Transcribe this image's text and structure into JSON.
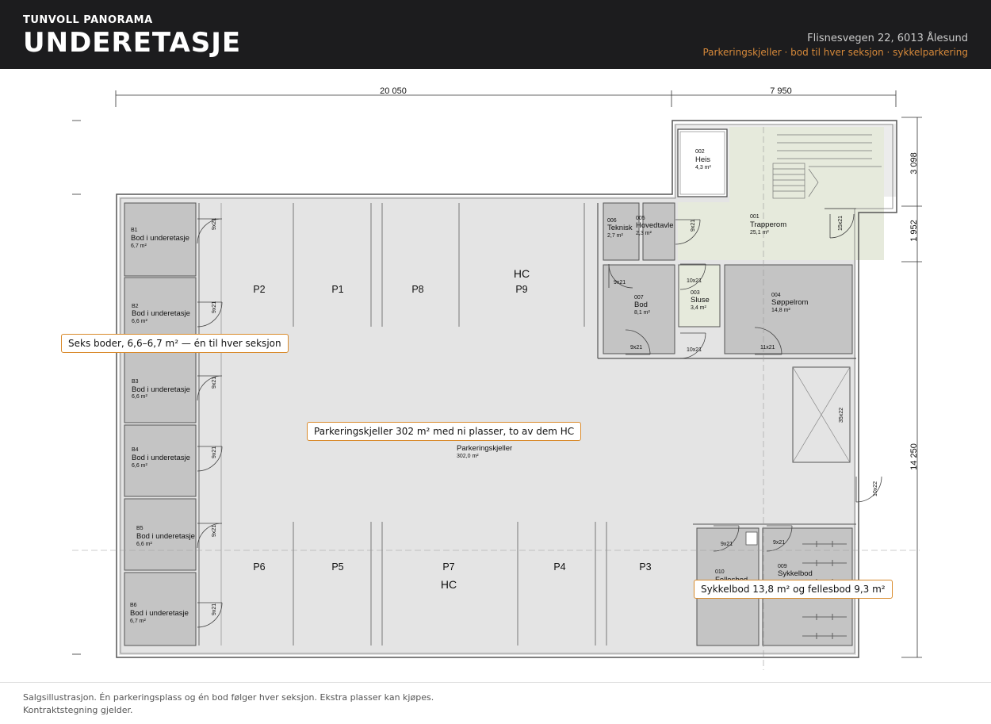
{
  "header": {
    "kicker": "TUNVOLL PANORAMA",
    "title": "UNDERETASJE",
    "address": "Flisnesvegen 22, 6013 Ålesund",
    "tagline": "Parkeringskjeller · bod til hver seksjon · sykkelparkering"
  },
  "dimensions": {
    "top_left": "20 050",
    "top_right": "7 950",
    "right_1": "3 098",
    "right_2": "1 952",
    "right_3": "14 250"
  },
  "storage": [
    {
      "code": "B1",
      "name": "Bod i underetasje",
      "area": "6,7 m²"
    },
    {
      "code": "B2",
      "name": "Bod i underetasje",
      "area": "6,6 m²"
    },
    {
      "code": "B3",
      "name": "Bod i underetasje",
      "area": "6,6 m²"
    },
    {
      "code": "B4",
      "name": "Bod i underetasje",
      "area": "6,6 m²"
    },
    {
      "code": "B5",
      "name": "Bod i underetasje",
      "area": "6,6 m²"
    },
    {
      "code": "B6",
      "name": "Bod i underetasje",
      "area": "6,7 m²"
    }
  ],
  "rooms": [
    {
      "code": "002",
      "name": "Heis",
      "area": "4,3 m²"
    },
    {
      "code": "001",
      "name": "Trapperom",
      "area": "25,1 m²"
    },
    {
      "code": "006",
      "name": "Teknisk",
      "area": "2,7 m²"
    },
    {
      "code": "005",
      "name": "Hovedtavle",
      "area": "2,3 m²"
    },
    {
      "code": "007",
      "name": "Bod",
      "area": "8,1 m²"
    },
    {
      "code": "003",
      "name": "Sluse",
      "area": "3,4 m²"
    },
    {
      "code": "004",
      "name": "Søppelrom",
      "area": "14,8 m²"
    },
    {
      "code": "010",
      "name": "Fellesbod",
      "area": ""
    },
    {
      "code": "009",
      "name": "Sykkelbod",
      "area": ""
    }
  ],
  "garage": {
    "name": "Parkeringskjeller",
    "area": "302,0 m²"
  },
  "parking_top": [
    "P2",
    "P1",
    "P8",
    "P9"
  ],
  "parking_bottom": [
    "P6",
    "P5",
    "P7",
    "P4",
    "P3"
  ],
  "hc_label": "HC",
  "doors": {
    "d9x21": "9x21",
    "d10x21": "10x21",
    "d11x21": "11x21",
    "d15x21": "15x21",
    "d10x22": "10x22",
    "d35x22": "35x22"
  },
  "callouts": {
    "storage": "Seks boder, 6,6–6,7 m² — én til hver seksjon",
    "garage": "Parkeringskjeller 302 m² med ni plasser, to av dem HC",
    "bike": "Sykkelbod 13,8 m² og fellesbod 9,3 m²"
  },
  "footer": "Salgsillustrasjon. Én parkeringsplass og én bod følger hver seksjon. Ekstra plasser kan kjøpes. Kontraktstegning gjelder."
}
